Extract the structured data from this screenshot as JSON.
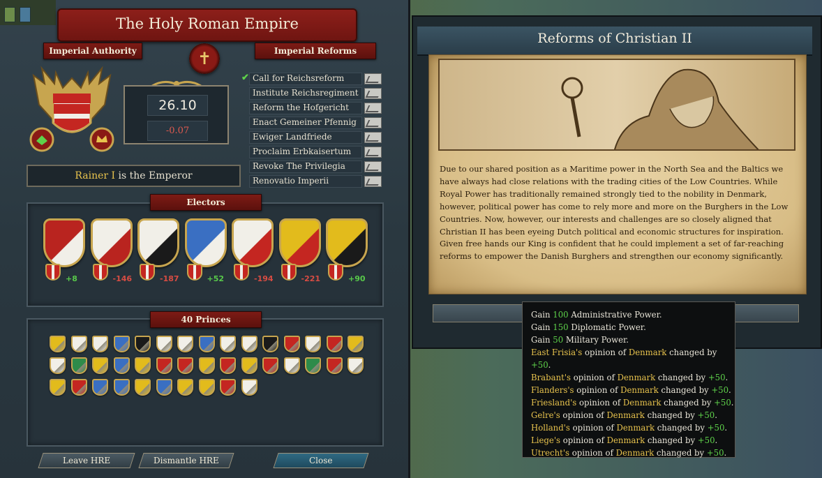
{
  "hre": {
    "title": "The Holy Roman Empire",
    "authority_label": "Imperial Authority",
    "reforms_label": "Imperial Reforms",
    "authority_value": "26.10",
    "authority_change": "-0.07",
    "emperor_name": "Rainer I",
    "emperor_suffix": " is the Emperor",
    "reforms": [
      {
        "label": "Call for Reichsreform",
        "passed": true
      },
      {
        "label": "Institute Reichsregiment",
        "passed": false
      },
      {
        "label": "Reform the Hofgericht",
        "passed": false
      },
      {
        "label": "Enact Gemeiner Pfennig",
        "passed": false
      },
      {
        "label": "Ewiger Landfriede",
        "passed": false
      },
      {
        "label": "Proclaim Erbkaisertum",
        "passed": false
      },
      {
        "label": "Revoke The Privilegia",
        "passed": false
      },
      {
        "label": "Renovatio Imperii",
        "passed": false
      }
    ],
    "electors_label": "Electors",
    "electors": [
      {
        "value": "+8",
        "color": "#b9241f",
        "accent": "#f1efe8",
        "positive": true
      },
      {
        "value": "-146",
        "color": "#f1efe8",
        "accent": "#b9241f",
        "positive": false
      },
      {
        "value": "-187",
        "color": "#f1efe8",
        "accent": "#1a1a1a",
        "positive": false
      },
      {
        "value": "+52",
        "color": "#3a6fc2",
        "accent": "#f1efe8",
        "positive": true
      },
      {
        "value": "-194",
        "color": "#f1efe8",
        "accent": "#c42621",
        "positive": false
      },
      {
        "value": "-221",
        "color": "#e2bb1c",
        "accent": "#c42621",
        "positive": false
      },
      {
        "value": "+90",
        "color": "#e2bb1c",
        "accent": "#1a1a1a",
        "positive": true
      }
    ],
    "princes_label": "40 Princes",
    "princes_colors": [
      "#e2bb1c",
      "#f1efe8",
      "#f1efe8",
      "#3a6fc2",
      "#1a1a1a",
      "#f1efe8",
      "#f1efe8",
      "#3a6fc2",
      "#f1efe8",
      "#f1efe8",
      "#1a1a1a",
      "#c42621",
      "#f1efe8",
      "#c42621",
      "#e2bb1c",
      "#f1efe8",
      "#2e8b4a",
      "#e2bb1c",
      "#3a6fc2",
      "#e2bb1c",
      "#c42621",
      "#c42621",
      "#e2bb1c",
      "#c42621",
      "#e2bb1c",
      "#c42621",
      "#f1efe8",
      "#2e8b4a",
      "#c42621",
      "#f1efe8",
      "#e2bb1c",
      "#c42621",
      "#3a6fc2",
      "#3a6fc2",
      "#e2bb1c",
      "#3a6fc2",
      "#e2bb1c",
      "#e2bb1c",
      "#c42621",
      "#f1efe8"
    ],
    "buttons": {
      "leave": "Leave HRE",
      "dismantle": "Dismantle HRE",
      "close": "Close"
    }
  },
  "event": {
    "title": "Reforms of Christian II",
    "paragraph1": "Due to our shared position as a Maritime power in the North Sea and the Baltics we have always had close relations with the trading cities of the Low Countries. While Royal Power has traditionally remained strongly tied to the nobility in Denmark, however, political power has come to rely more and more on the Burghers in the Low Countries. Now, however, our interests and challenges are so closely aligned that Christian II has been eyeing Dutch political and economic structures for inspiration.",
    "paragraph2": "Given free hands our King is confident that he could implement a set of far-reaching reforms to empower the Danish Burghers and strengthen our economy significantly."
  },
  "tooltip": {
    "gains": [
      {
        "prefix": "Gain ",
        "amount": "100",
        "suffix": " Administrative Power."
      },
      {
        "prefix": "Gain ",
        "amount": "150",
        "suffix": " Diplomatic Power."
      },
      {
        "prefix": "Gain ",
        "amount": "50",
        "suffix": " Military Power."
      }
    ],
    "opinions": [
      {
        "country": "East Frisia's",
        "text": " opinion of ",
        "target": "Denmark",
        "mid": " changed by ",
        "value": "+50",
        "end": "."
      },
      {
        "country": "Brabant's",
        "text": " opinion of ",
        "target": "Denmark",
        "mid": " changed by ",
        "value": "+50",
        "end": "."
      },
      {
        "country": "Flanders's",
        "text": " opinion of ",
        "target": "Denmark",
        "mid": " changed by ",
        "value": "+50",
        "end": "."
      },
      {
        "country": "Friesland's",
        "text": " opinion of ",
        "target": "Denmark",
        "mid": " changed by ",
        "value": "+50",
        "end": "."
      },
      {
        "country": "Gelre's",
        "text": " opinion of ",
        "target": "Denmark",
        "mid": " changed by ",
        "value": "+50",
        "end": "."
      },
      {
        "country": "Holland's",
        "text": " opinion of ",
        "target": "Denmark",
        "mid": " changed by ",
        "value": "+50",
        "end": "."
      },
      {
        "country": "Liege's",
        "text": " opinion of ",
        "target": "Denmark",
        "mid": " changed by ",
        "value": "+50",
        "end": "."
      },
      {
        "country": "Utrecht's",
        "text": " opinion of ",
        "target": "Denmark",
        "mid": " changed by ",
        "value": "+50",
        "end": "."
      }
    ]
  }
}
